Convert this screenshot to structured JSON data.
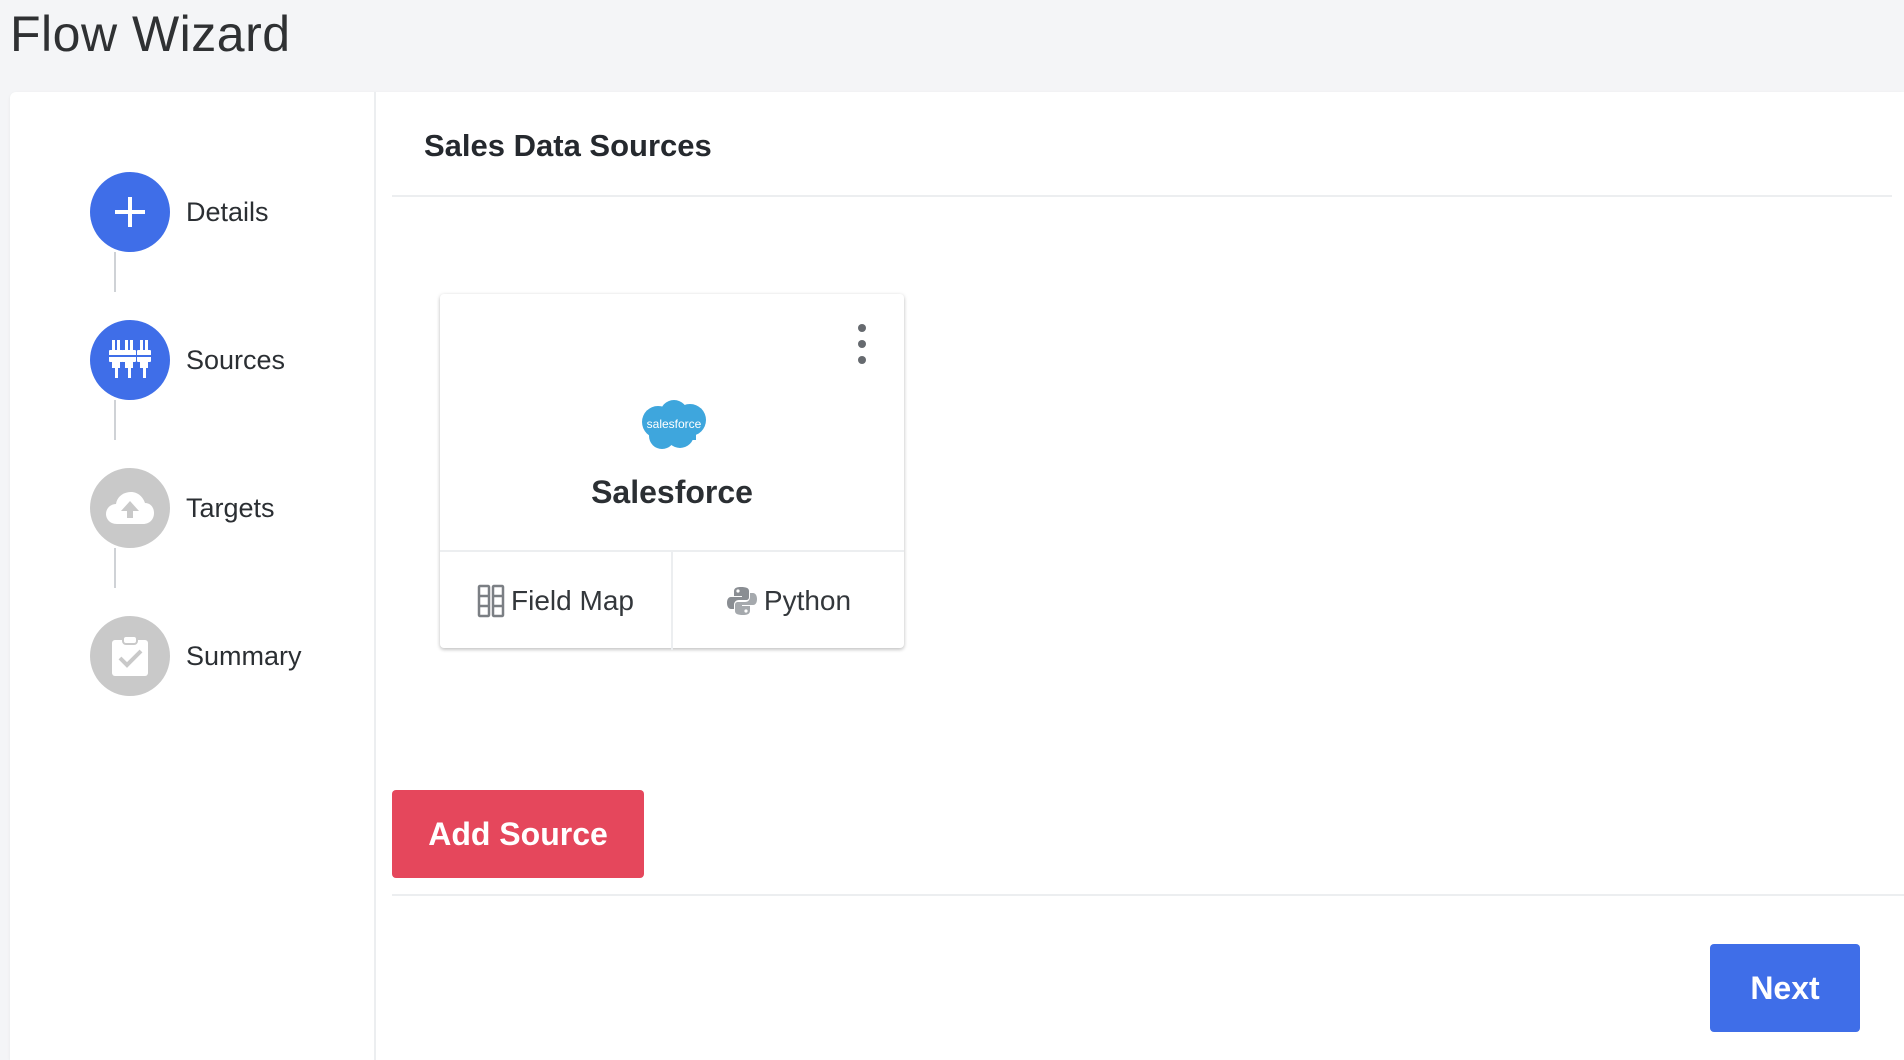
{
  "page": {
    "title": "Flow Wizard"
  },
  "steps": [
    {
      "label": "Details",
      "icon": "plus-icon",
      "state": "active"
    },
    {
      "label": "Sources",
      "icon": "connector-icon",
      "state": "active"
    },
    {
      "label": "Targets",
      "icon": "cloud-upload-icon",
      "state": "inactive"
    },
    {
      "label": "Summary",
      "icon": "clipboard-check-icon",
      "state": "inactive"
    }
  ],
  "main": {
    "section_title": "Sales Data Sources",
    "source_card": {
      "logo_text": "salesforce",
      "name": "Salesforce",
      "actions": [
        {
          "label": "Field Map",
          "icon": "field-map-icon"
        },
        {
          "label": "Python",
          "icon": "python-icon"
        }
      ]
    },
    "add_source_label": "Add Source",
    "next_label": "Next"
  },
  "colors": {
    "active_step": "#3f6ee8",
    "inactive_step": "#c9c9c9",
    "add_button": "#e5475c",
    "next_button": "#3f6ee8",
    "salesforce_blue": "#3ea6dd"
  }
}
